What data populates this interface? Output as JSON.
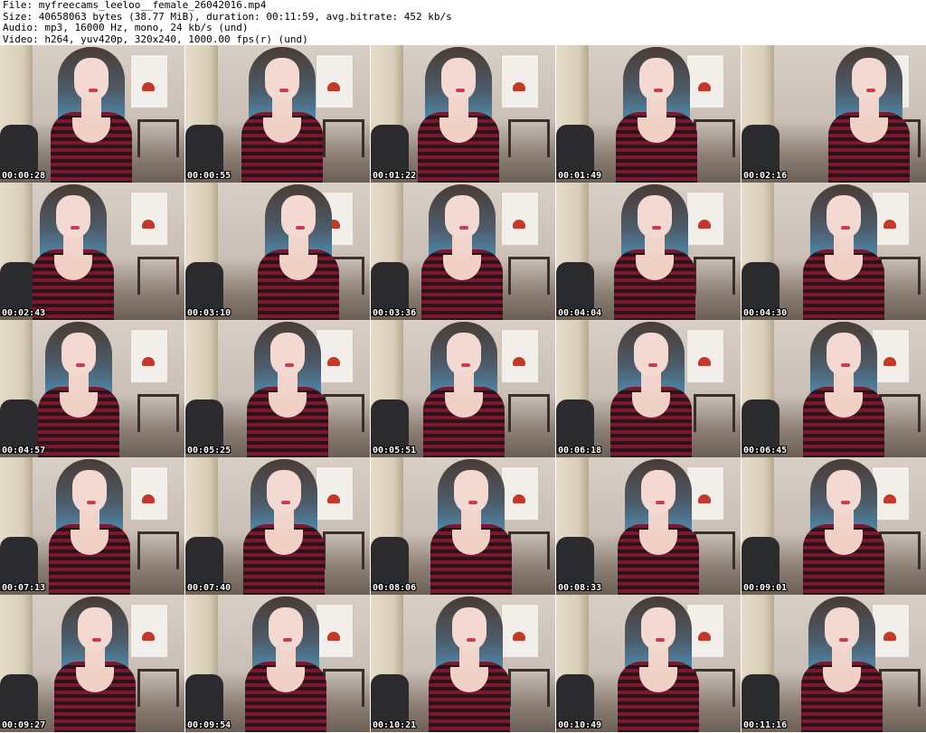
{
  "header": {
    "lines": [
      "File: myfreecams_leeloo__female_26042016.mp4",
      "Size: 40658063 bytes (38.77 MiB), duration: 00:11:59, avg.bitrate: 452 kb/s",
      "Audio: mp3, 16000 Hz, mono, 24 kb/s (und)",
      "Video: h264, yuv420p, 320x240, 1000.00 fps(r) (und)"
    ]
  },
  "thumbnails": [
    {
      "timestamp": "00:00:28"
    },
    {
      "timestamp": "00:00:55"
    },
    {
      "timestamp": "00:01:22"
    },
    {
      "timestamp": "00:01:49"
    },
    {
      "timestamp": "00:02:16"
    },
    {
      "timestamp": "00:02:43"
    },
    {
      "timestamp": "00:03:10"
    },
    {
      "timestamp": "00:03:36"
    },
    {
      "timestamp": "00:04:04"
    },
    {
      "timestamp": "00:04:30"
    },
    {
      "timestamp": "00:04:57"
    },
    {
      "timestamp": "00:05:25"
    },
    {
      "timestamp": "00:05:51"
    },
    {
      "timestamp": "00:06:18"
    },
    {
      "timestamp": "00:06:45"
    },
    {
      "timestamp": "00:07:13"
    },
    {
      "timestamp": "00:07:40"
    },
    {
      "timestamp": "00:08:06"
    },
    {
      "timestamp": "00:08:33"
    },
    {
      "timestamp": "00:09:01"
    },
    {
      "timestamp": "00:09:27"
    },
    {
      "timestamp": "00:09:54"
    },
    {
      "timestamp": "00:10:21"
    },
    {
      "timestamp": "00:10:49"
    },
    {
      "timestamp": "00:11:16"
    }
  ],
  "colors": {
    "background": "#ffffff",
    "header_text": "#000000",
    "timestamp_text": "#ffffff",
    "timestamp_outline": "#000000"
  }
}
